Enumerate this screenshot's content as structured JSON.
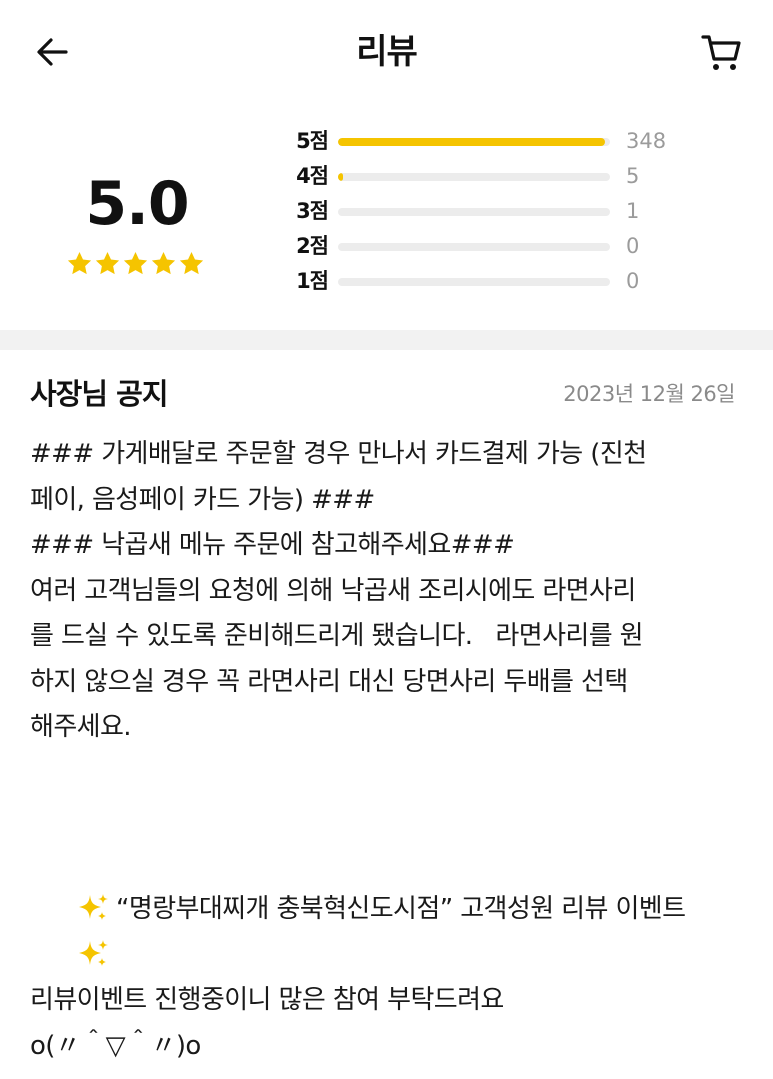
{
  "header": {
    "title": "리뷰",
    "back_icon": "arrow-left-icon",
    "cart_icon": "shopping-cart-icon"
  },
  "rating": {
    "score": "5.0",
    "stars_filled": 5,
    "star_color": "#f5c400",
    "distribution": [
      {
        "label": "5점",
        "count": "348",
        "fraction": 0.982
      },
      {
        "label": "4점",
        "count": "5",
        "fraction": 0.014
      },
      {
        "label": "3점",
        "count": "1",
        "fraction": 0.0
      },
      {
        "label": "2점",
        "count": "0",
        "fraction": 0.0
      },
      {
        "label": "1점",
        "count": "0",
        "fraction": 0.0
      }
    ]
  },
  "notice": {
    "title": "사장님 공지",
    "date": "2023년 12월 26일",
    "lines": [
      "### 가게배달로 주문할 경우 만나서 카드결제 가능 (진천",
      "페이, 음성페이 카드 가능) ###",
      "### 낙곱새 메뉴 주문에 참고해주세요###",
      "여러 고객님들의 요청에 의해 낙곱새 조리시에도 라면사리",
      "를 드실 수 있도록 준비해드리게 됐습니다.   라면사리를 원",
      "하지 않으실 경우 꼭 라면사리 대신 당면사리 두배를 선택",
      "해주세요.",
      "",
      "",
      "“명랑부대찌개 충북혁신도시점” 고객성원 리뷰 이벤트",
      "",
      "",
      "리뷰이벤트 진행중이니 많은 참여 부탁드려요",
      "o(〃＾▽＾〃)o"
    ],
    "sparkle_icon": "sparkles-icon"
  }
}
